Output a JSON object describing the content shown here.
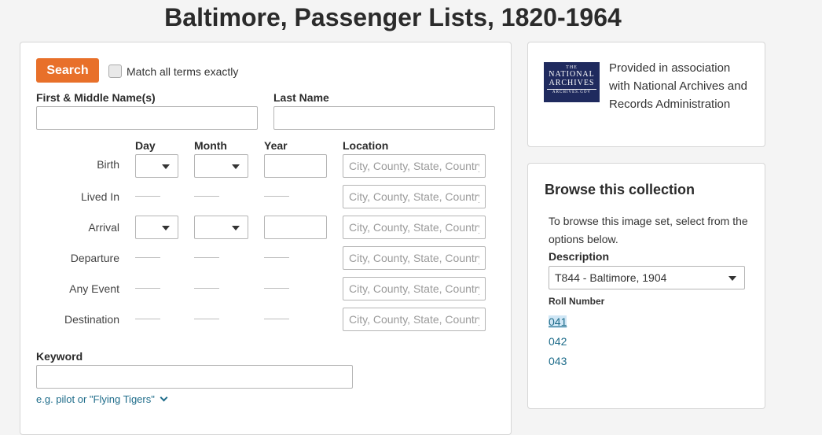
{
  "page": {
    "title": "Baltimore, Passenger Lists, 1820-1964"
  },
  "search": {
    "button_label": "Search",
    "match_exact_label": "Match all terms exactly",
    "first_name_label": "First & Middle Name(s)",
    "last_name_label": "Last Name",
    "columns": {
      "day": "Day",
      "month": "Month",
      "year": "Year",
      "location": "Location"
    },
    "location_placeholder": "City, County, State, Country",
    "events": [
      {
        "label": "Birth"
      },
      {
        "label": "Lived In"
      },
      {
        "label": "Arrival"
      },
      {
        "label": "Departure"
      },
      {
        "label": "Any Event"
      },
      {
        "label": "Destination"
      }
    ],
    "keyword_label": "Keyword",
    "keyword_hint": "e.g. pilot or \"Flying Tigers\""
  },
  "provider": {
    "logo_line1": "THE",
    "logo_line2": "NATIONAL",
    "logo_line3": "ARCHIVES",
    "logo_line4": "ARCHIVES.GOV",
    "text": "Provided in association with National Archives and Records Administration"
  },
  "browse": {
    "title": "Browse this collection",
    "desc": "To browse this image set, select from the options below.",
    "description_label": "Description",
    "description_value": "T844 - Baltimore, 1904",
    "roll_label": "Roll Number",
    "rolls": [
      "041",
      "042",
      "043"
    ]
  }
}
